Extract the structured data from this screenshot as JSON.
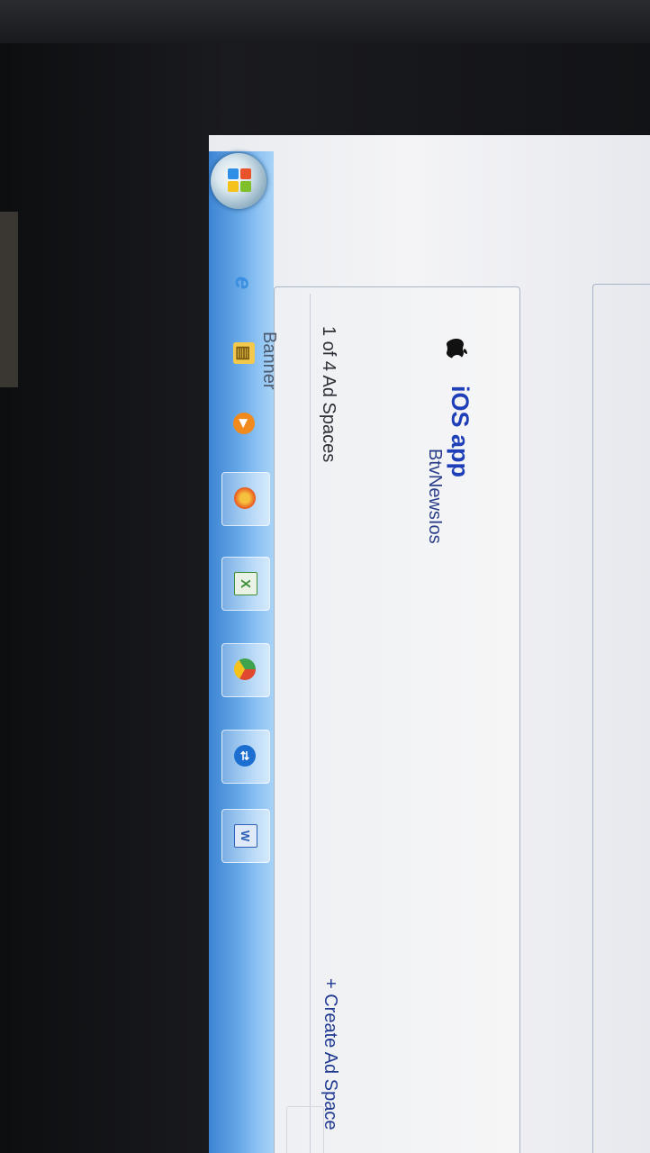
{
  "app": {
    "platform_label": "iOS app",
    "app_name": "BtvNewsIos"
  },
  "ad_spaces": {
    "count_text": "1 of 4 Ad Spaces",
    "tab_label": "Banner",
    "create_label": "+ Create Ad Space"
  },
  "taskbar": {
    "items": [
      {
        "icon": "internet-explorer-icon",
        "glyph": "e",
        "color": "#3a8fe0"
      },
      {
        "icon": "file-explorer-icon",
        "glyph": "▤",
        "color": "#f2c94c"
      },
      {
        "icon": "media-player-icon",
        "glyph": "▶",
        "color": "#f08a1c"
      },
      {
        "icon": "firefox-icon",
        "glyph": "◉",
        "color": "#e8551f"
      },
      {
        "icon": "excel-icon",
        "glyph": "X",
        "color": "#3f8f3a"
      },
      {
        "icon": "chrome-icon",
        "glyph": "◎",
        "color": "#e0a81f"
      },
      {
        "icon": "teamviewer-icon",
        "glyph": "⇄",
        "color": "#1c6fd1"
      },
      {
        "icon": "word-icon",
        "glyph": "W",
        "color": "#2b5fb8"
      }
    ]
  },
  "colors": {
    "link": "#1f3fb8",
    "taskbar": "#64a6e6"
  }
}
